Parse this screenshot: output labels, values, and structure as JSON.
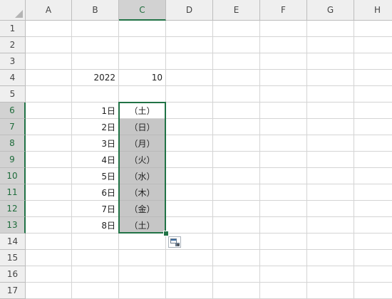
{
  "columns": [
    "A",
    "B",
    "C",
    "D",
    "E",
    "F",
    "G",
    "H"
  ],
  "rows": [
    "1",
    "2",
    "3",
    "4",
    "5",
    "6",
    "7",
    "8",
    "9",
    "10",
    "11",
    "12",
    "13",
    "14",
    "15",
    "16",
    "17"
  ],
  "selection": {
    "columns": [
      "C"
    ],
    "rows": [
      "6",
      "7",
      "8",
      "9",
      "10",
      "11",
      "12",
      "13"
    ]
  },
  "cells": [
    {
      "ref": "B4",
      "value": "2022",
      "align": "right"
    },
    {
      "ref": "C4",
      "value": "10",
      "align": "right"
    },
    {
      "ref": "B6",
      "value": "1日",
      "align": "right"
    },
    {
      "ref": "C6",
      "value": "（土）",
      "align": "center"
    },
    {
      "ref": "B7",
      "value": "2日",
      "align": "right"
    },
    {
      "ref": "C7",
      "value": "（日）",
      "align": "center",
      "shaded": true
    },
    {
      "ref": "B8",
      "value": "3日",
      "align": "right"
    },
    {
      "ref": "C8",
      "value": "（月）",
      "align": "center",
      "shaded": true
    },
    {
      "ref": "B9",
      "value": "4日",
      "align": "right"
    },
    {
      "ref": "C9",
      "value": "（火）",
      "align": "center",
      "shaded": true
    },
    {
      "ref": "B10",
      "value": "5日",
      "align": "right"
    },
    {
      "ref": "C10",
      "value": "（水）",
      "align": "center",
      "shaded": true
    },
    {
      "ref": "B11",
      "value": "6日",
      "align": "right"
    },
    {
      "ref": "C11",
      "value": "（木）",
      "align": "center",
      "shaded": true
    },
    {
      "ref": "B12",
      "value": "7日",
      "align": "right"
    },
    {
      "ref": "C12",
      "value": "（金）",
      "align": "center",
      "shaded": true
    },
    {
      "ref": "B13",
      "value": "8日",
      "align": "right"
    },
    {
      "ref": "C13",
      "value": "（土）",
      "align": "center",
      "shaded": true
    }
  ],
  "icons": {
    "autofill_options": "autofill-options-icon",
    "fill_handle": "fill-handle-icon",
    "select_all": "select-all-triangle-icon"
  },
  "colors": {
    "selection_border": "#217346",
    "selection_fill": "#c6c6c6",
    "header_bg": "#efefef",
    "header_selected_bg": "#d2d2d2",
    "gridline": "#d4d4d4"
  }
}
